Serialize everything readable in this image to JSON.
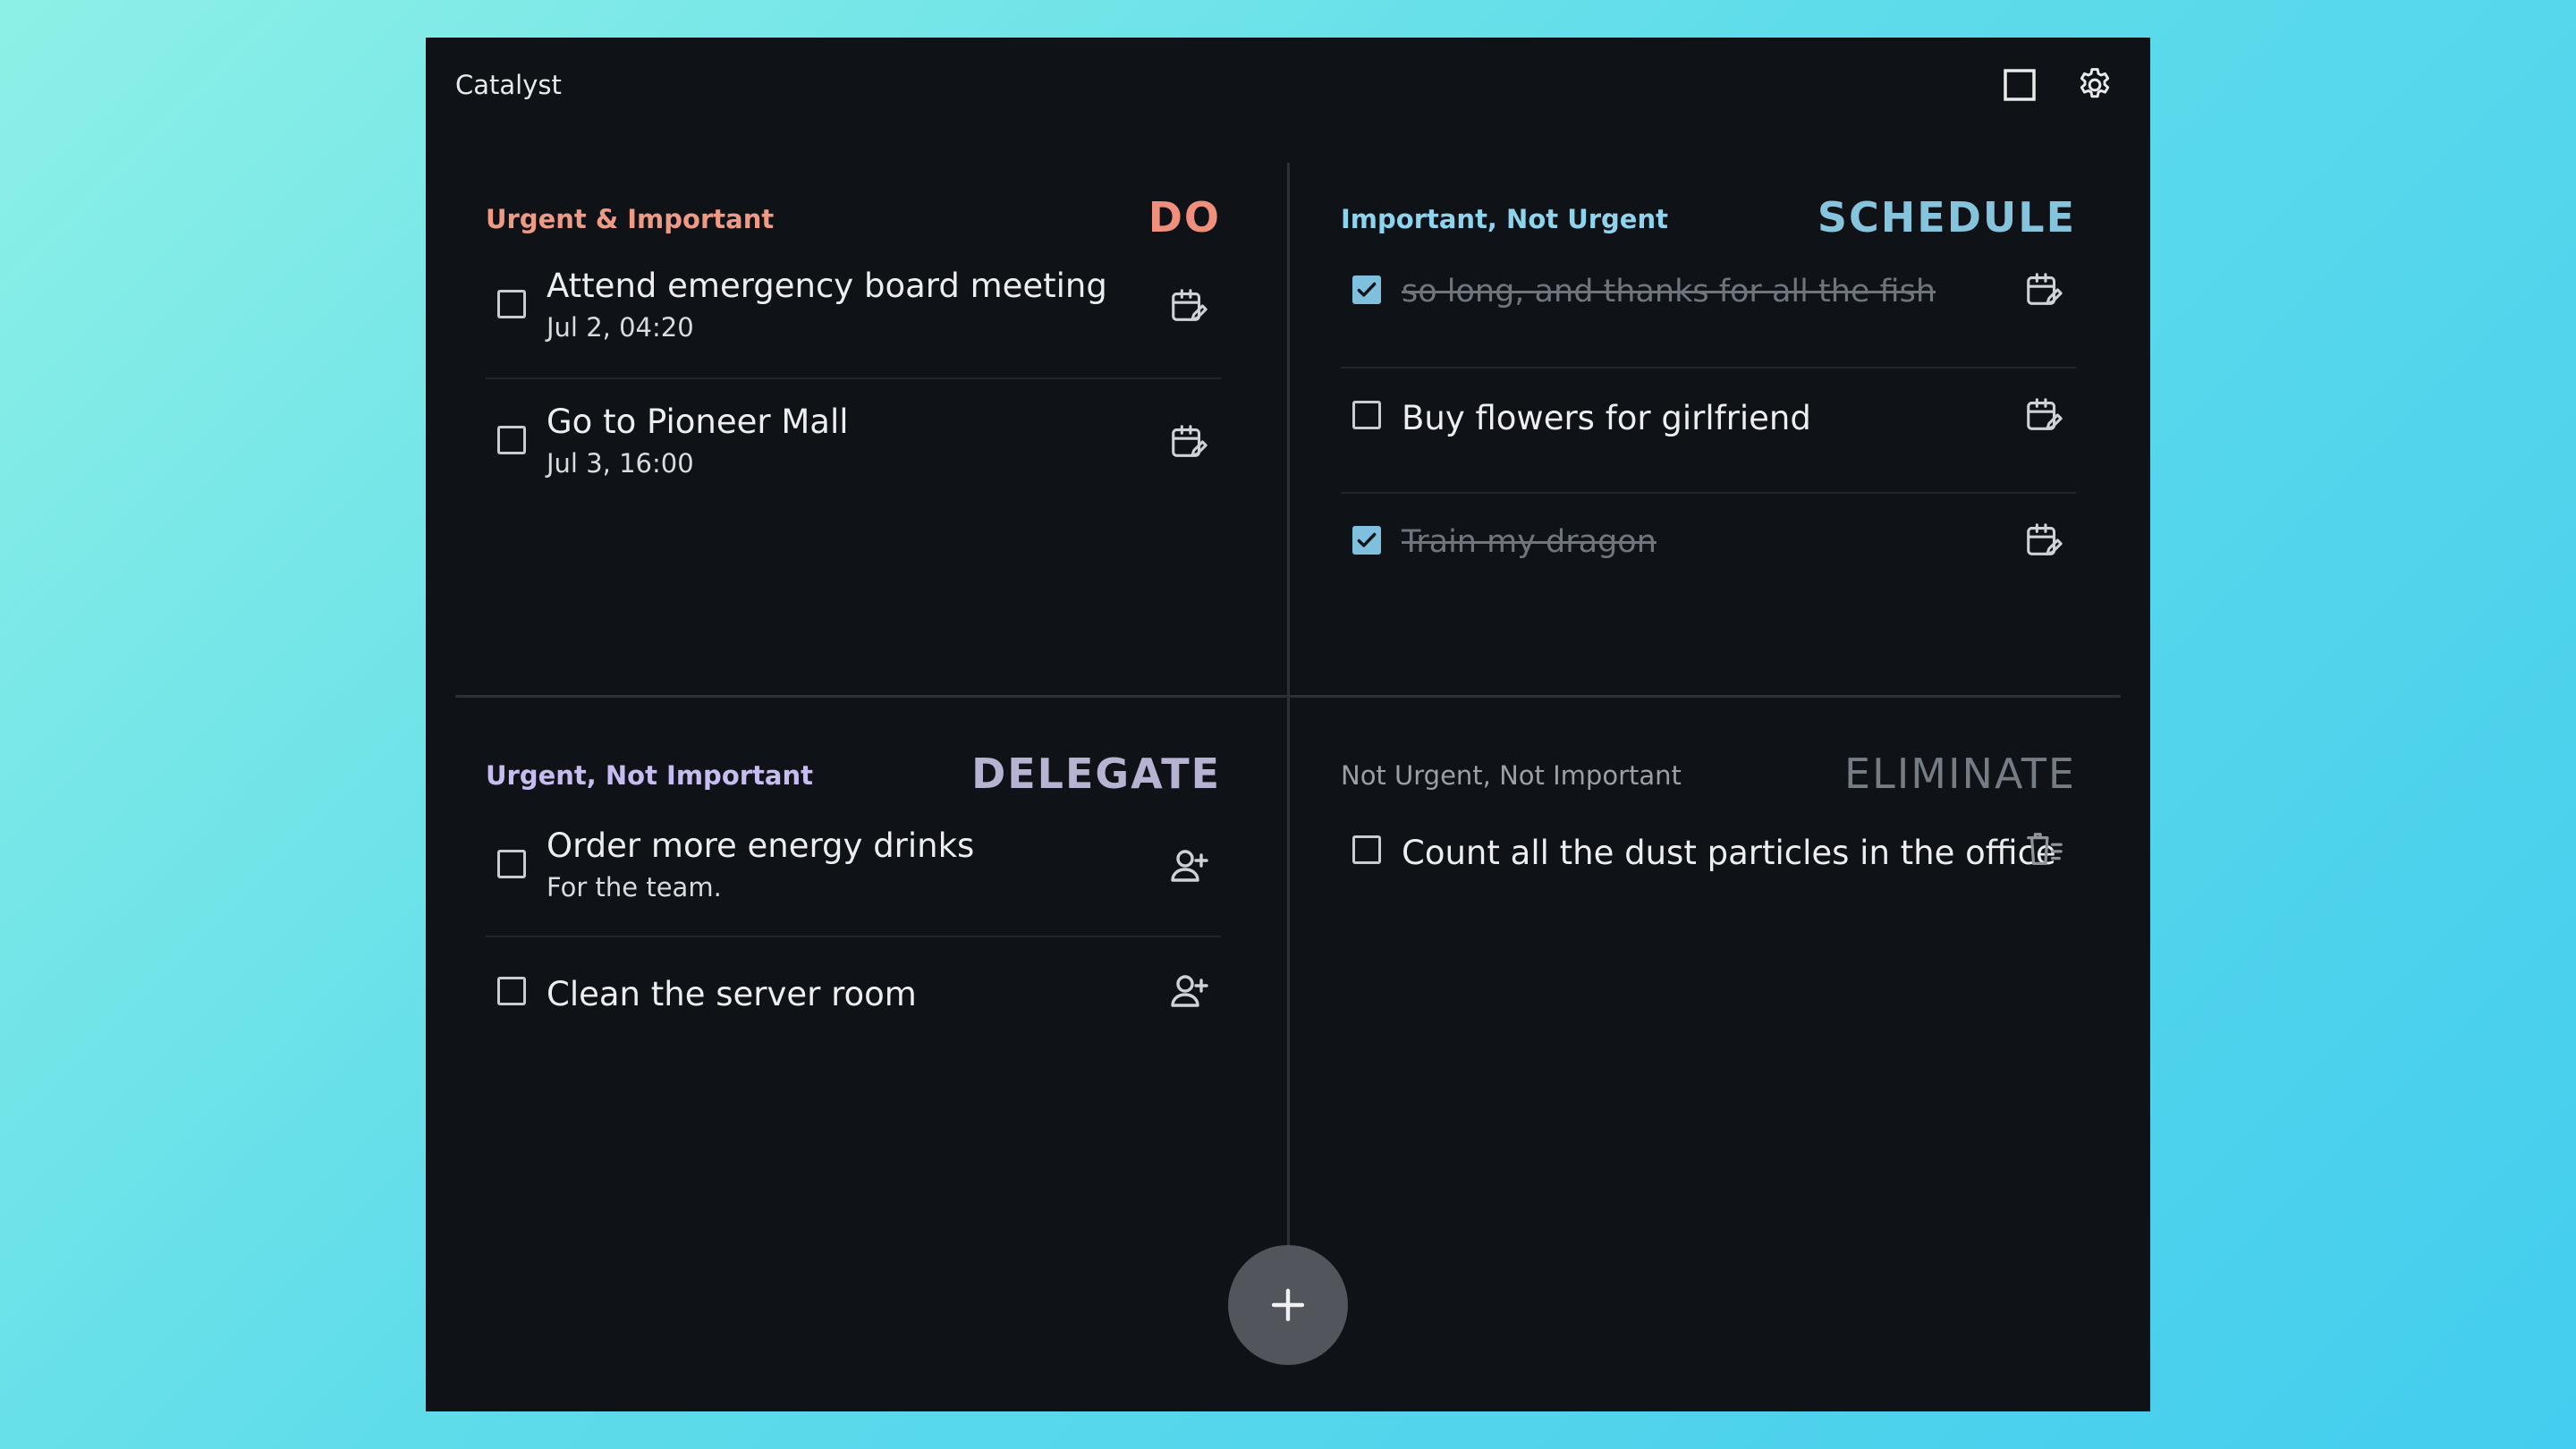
{
  "app": {
    "title": "Catalyst"
  },
  "top_icons": [
    "window-icon",
    "gear-icon"
  ],
  "quadrants": {
    "do": {
      "label": "Urgent & Important",
      "action": "DO",
      "color": "#ef8f7c",
      "tasks": [
        {
          "title": "Attend emergency board meeting",
          "subtitle": "Jul 2, 04:20",
          "checked": false,
          "action_icon": "calendar-edit-icon"
        },
        {
          "title": "Go to Pioneer Mall",
          "subtitle": "Jul 3, 16:00",
          "checked": false,
          "action_icon": "calendar-edit-icon"
        }
      ]
    },
    "schedule": {
      "label": "Important, Not Urgent",
      "action": "SCHEDULE",
      "color": "#86c4dd",
      "tasks": [
        {
          "title": "so long, and thanks for all the fish",
          "checked": true,
          "action_icon": "calendar-edit-icon"
        },
        {
          "title": "Buy flowers for girlfriend",
          "checked": false,
          "action_icon": "calendar-edit-icon"
        },
        {
          "title": "Train my dragon",
          "checked": true,
          "action_icon": "calendar-edit-icon"
        }
      ]
    },
    "delegate": {
      "label": "Urgent, Not Important",
      "action": "DELEGATE",
      "color": "#b8b2d2",
      "tasks": [
        {
          "title": "Order more energy drinks",
          "subtitle": "For the team.",
          "checked": false,
          "action_icon": "person-add-icon"
        },
        {
          "title": "Clean the server room",
          "checked": false,
          "action_icon": "person-add-icon"
        }
      ]
    },
    "eliminate": {
      "label": "Not Urgent, Not Important",
      "action": "ELIMINATE",
      "color": "#767c84",
      "tasks": [
        {
          "title": "Count all the dust particles in the office",
          "checked": false,
          "action_icon": "trash-list-icon"
        }
      ]
    }
  },
  "fab": {
    "icon": "plus-icon"
  }
}
